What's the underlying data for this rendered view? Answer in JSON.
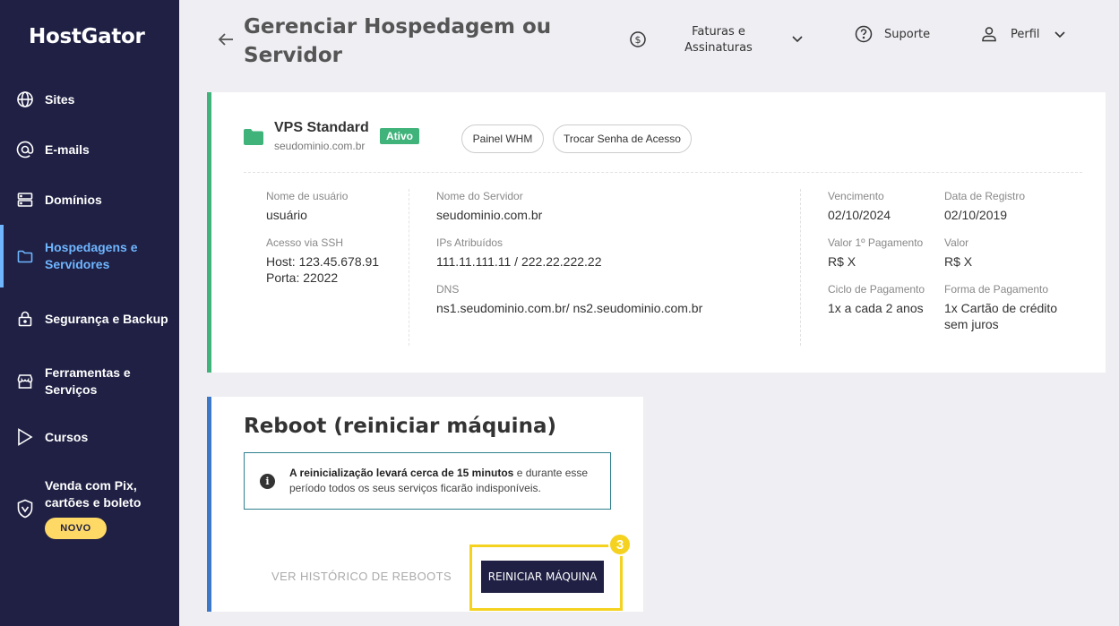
{
  "app": {
    "logo": "HostGator"
  },
  "sidebar": {
    "items": [
      {
        "label": "Sites",
        "icon": "globe-icon"
      },
      {
        "label": "E-mails",
        "icon": "at-icon"
      },
      {
        "label": "Domínios",
        "icon": "server-icon"
      },
      {
        "label": "Hospedagens e Servidores",
        "icon": "folder-icon",
        "active": true
      },
      {
        "label": "Segurança e Backup",
        "icon": "lock-icon"
      },
      {
        "label": "Ferramentas e Serviços",
        "icon": "store-icon"
      },
      {
        "label": "Cursos",
        "icon": "play-icon"
      },
      {
        "label": "Venda com Pix, cartões e boleto",
        "icon": "shield-icon"
      }
    ],
    "novo_badge": "NOVO"
  },
  "header": {
    "title": "Gerenciar Hospedagem ou Servidor",
    "billing": "Faturas e Assinaturas",
    "support": "Suporte",
    "profile": "Perfil"
  },
  "service": {
    "name": "VPS Standard",
    "domain": "seudominio.com.br",
    "status": "Ativo",
    "btn_whm": "Painel WHM",
    "btn_password": "Trocar Senha de Acesso",
    "fields": {
      "username_label": "Nome de usuário",
      "username": "usuário",
      "ssh_label": "Acesso via SSH",
      "ssh_host": "Host: 123.45.678.91",
      "ssh_port": "Porta: 22022",
      "server_label": "Nome do Servidor",
      "server": "seudominio.com.br",
      "ips_label": "IPs Atribuídos",
      "ips": "111.11.111.11 / 222.22.222.22",
      "dns_label": "DNS",
      "dns": "ns1.seudominio.com.br/ ns2.seudominio.com.br",
      "due_label": "Vencimento",
      "due": "02/10/2024",
      "reg_label": "Data de Registro",
      "reg": "02/10/2019",
      "first_pay_label": "Valor 1º Pagamento",
      "first_pay": "R$ X",
      "value_label": "Valor",
      "value": "R$ X",
      "cycle_label": "Ciclo de Pagamento",
      "cycle": "1x a cada 2 anos",
      "pay_method_label": "Forma de Pagamento",
      "pay_method": "1x Cartão de crédito sem juros"
    }
  },
  "reboot": {
    "title": "Reboot (reiniciar máquina)",
    "info_bold": "A reinicialização levará cerca de 15 minutos",
    "info_rest": " e durante esse período todos os seus serviços ficarão indisponíveis.",
    "history_link": "VER HISTÓRICO DE REBOOTS",
    "button": "REINICIAR MÁQUINA",
    "step": "3"
  },
  "colors": {
    "sidebar_bg": "#1f2044",
    "active_accent": "#6fb6ff",
    "status_green": "#3fb37a",
    "reboot_accent": "#3d77c8",
    "highlight_yellow": "#f5d21f"
  }
}
